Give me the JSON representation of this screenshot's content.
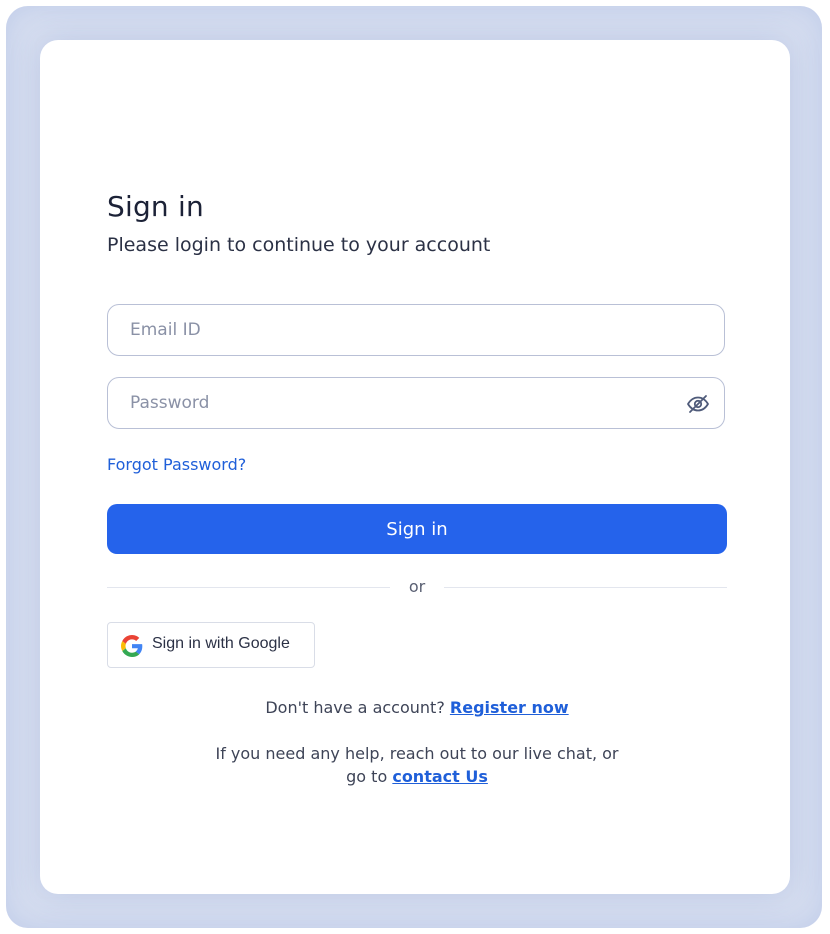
{
  "heading": {
    "title": "Sign in",
    "subtitle": "Please login to continue to your account"
  },
  "form": {
    "email_placeholder": "Email ID",
    "email_value": "",
    "password_placeholder": "Password",
    "password_value": "",
    "forgot_label": "Forgot Password?",
    "submit_label": "Sign in"
  },
  "divider": {
    "label": "or"
  },
  "google": {
    "label": "Sign in with Google",
    "icon": "google-logo-icon"
  },
  "register": {
    "prompt": "Don't have a account?",
    "link_label": "Register now"
  },
  "help": {
    "line1": "If you need any help, reach out to our live chat, or",
    "line2_prefix": "go to",
    "link_label": "contact Us"
  },
  "colors": {
    "primary": "#2563eb",
    "link": "#1f5fd9",
    "frame": "#d6def0",
    "text": "#1c2237"
  }
}
